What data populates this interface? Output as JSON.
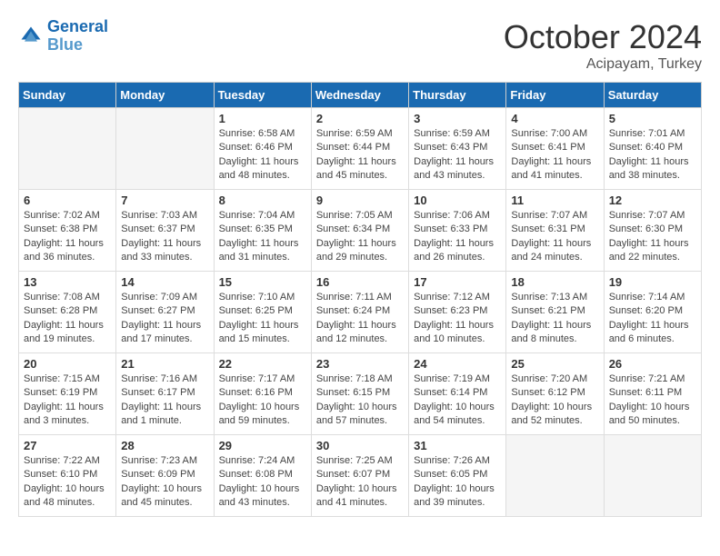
{
  "header": {
    "logo_line1": "General",
    "logo_line2": "Blue",
    "month": "October 2024",
    "location": "Acipayam, Turkey"
  },
  "weekdays": [
    "Sunday",
    "Monday",
    "Tuesday",
    "Wednesday",
    "Thursday",
    "Friday",
    "Saturday"
  ],
  "weeks": [
    [
      {
        "day": "",
        "empty": true
      },
      {
        "day": "",
        "empty": true
      },
      {
        "day": "1",
        "sunrise": "6:58 AM",
        "sunset": "6:46 PM",
        "daylight": "11 hours and 48 minutes."
      },
      {
        "day": "2",
        "sunrise": "6:59 AM",
        "sunset": "6:44 PM",
        "daylight": "11 hours and 45 minutes."
      },
      {
        "day": "3",
        "sunrise": "6:59 AM",
        "sunset": "6:43 PM",
        "daylight": "11 hours and 43 minutes."
      },
      {
        "day": "4",
        "sunrise": "7:00 AM",
        "sunset": "6:41 PM",
        "daylight": "11 hours and 41 minutes."
      },
      {
        "day": "5",
        "sunrise": "7:01 AM",
        "sunset": "6:40 PM",
        "daylight": "11 hours and 38 minutes."
      }
    ],
    [
      {
        "day": "6",
        "sunrise": "7:02 AM",
        "sunset": "6:38 PM",
        "daylight": "11 hours and 36 minutes."
      },
      {
        "day": "7",
        "sunrise": "7:03 AM",
        "sunset": "6:37 PM",
        "daylight": "11 hours and 33 minutes."
      },
      {
        "day": "8",
        "sunrise": "7:04 AM",
        "sunset": "6:35 PM",
        "daylight": "11 hours and 31 minutes."
      },
      {
        "day": "9",
        "sunrise": "7:05 AM",
        "sunset": "6:34 PM",
        "daylight": "11 hours and 29 minutes."
      },
      {
        "day": "10",
        "sunrise": "7:06 AM",
        "sunset": "6:33 PM",
        "daylight": "11 hours and 26 minutes."
      },
      {
        "day": "11",
        "sunrise": "7:07 AM",
        "sunset": "6:31 PM",
        "daylight": "11 hours and 24 minutes."
      },
      {
        "day": "12",
        "sunrise": "7:07 AM",
        "sunset": "6:30 PM",
        "daylight": "11 hours and 22 minutes."
      }
    ],
    [
      {
        "day": "13",
        "sunrise": "7:08 AM",
        "sunset": "6:28 PM",
        "daylight": "11 hours and 19 minutes."
      },
      {
        "day": "14",
        "sunrise": "7:09 AM",
        "sunset": "6:27 PM",
        "daylight": "11 hours and 17 minutes."
      },
      {
        "day": "15",
        "sunrise": "7:10 AM",
        "sunset": "6:25 PM",
        "daylight": "11 hours and 15 minutes."
      },
      {
        "day": "16",
        "sunrise": "7:11 AM",
        "sunset": "6:24 PM",
        "daylight": "11 hours and 12 minutes."
      },
      {
        "day": "17",
        "sunrise": "7:12 AM",
        "sunset": "6:23 PM",
        "daylight": "11 hours and 10 minutes."
      },
      {
        "day": "18",
        "sunrise": "7:13 AM",
        "sunset": "6:21 PM",
        "daylight": "11 hours and 8 minutes."
      },
      {
        "day": "19",
        "sunrise": "7:14 AM",
        "sunset": "6:20 PM",
        "daylight": "11 hours and 6 minutes."
      }
    ],
    [
      {
        "day": "20",
        "sunrise": "7:15 AM",
        "sunset": "6:19 PM",
        "daylight": "11 hours and 3 minutes."
      },
      {
        "day": "21",
        "sunrise": "7:16 AM",
        "sunset": "6:17 PM",
        "daylight": "11 hours and 1 minute."
      },
      {
        "day": "22",
        "sunrise": "7:17 AM",
        "sunset": "6:16 PM",
        "daylight": "10 hours and 59 minutes."
      },
      {
        "day": "23",
        "sunrise": "7:18 AM",
        "sunset": "6:15 PM",
        "daylight": "10 hours and 57 minutes."
      },
      {
        "day": "24",
        "sunrise": "7:19 AM",
        "sunset": "6:14 PM",
        "daylight": "10 hours and 54 minutes."
      },
      {
        "day": "25",
        "sunrise": "7:20 AM",
        "sunset": "6:12 PM",
        "daylight": "10 hours and 52 minutes."
      },
      {
        "day": "26",
        "sunrise": "7:21 AM",
        "sunset": "6:11 PM",
        "daylight": "10 hours and 50 minutes."
      }
    ],
    [
      {
        "day": "27",
        "sunrise": "7:22 AM",
        "sunset": "6:10 PM",
        "daylight": "10 hours and 48 minutes."
      },
      {
        "day": "28",
        "sunrise": "7:23 AM",
        "sunset": "6:09 PM",
        "daylight": "10 hours and 45 minutes."
      },
      {
        "day": "29",
        "sunrise": "7:24 AM",
        "sunset": "6:08 PM",
        "daylight": "10 hours and 43 minutes."
      },
      {
        "day": "30",
        "sunrise": "7:25 AM",
        "sunset": "6:07 PM",
        "daylight": "10 hours and 41 minutes."
      },
      {
        "day": "31",
        "sunrise": "7:26 AM",
        "sunset": "6:05 PM",
        "daylight": "10 hours and 39 minutes."
      },
      {
        "day": "",
        "empty": true
      },
      {
        "day": "",
        "empty": true
      }
    ]
  ]
}
